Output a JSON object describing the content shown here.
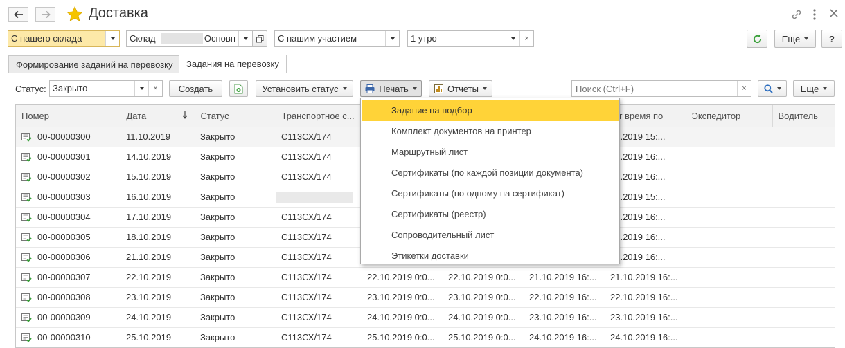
{
  "header": {
    "title": "Доставка"
  },
  "filters": {
    "warehouse_filter": "С нашего склада",
    "warehouse_label": "Склад",
    "warehouse_value_suffix": "Основн",
    "participation": "С нашим участием",
    "shift": "1 утро",
    "more_label": "Еще",
    "help_label": "?"
  },
  "tabs": [
    {
      "label": "Формирование заданий на перевозку",
      "active": false
    },
    {
      "label": "Задания на перевозку",
      "active": true
    }
  ],
  "toolbar": {
    "status_label": "Статус:",
    "status_value": "Закрыто",
    "create_label": "Создать",
    "set_status_label": "Установить статус",
    "print_label": "Печать",
    "reports_label": "Отчеты",
    "search_placeholder": "Поиск (Ctrl+F)",
    "more_label": "Еще"
  },
  "table": {
    "columns": [
      "Номер",
      "Дата",
      "Статус",
      "Транспортное с...",
      "",
      "",
      "",
      "Факт время по",
      "Экспедитор",
      "Водитель"
    ],
    "sort_column": "Дата",
    "rows": [
      {
        "num": "00-00000300",
        "date": "11.10.2019",
        "status": "Закрыто",
        "transport": "С113СХ/174",
        "c4": "",
        "c5": "",
        "c6": "",
        "fact": "10.2019 15:..."
      },
      {
        "num": "00-00000301",
        "date": "14.10.2019",
        "status": "Закрыто",
        "transport": "С113СХ/174",
        "c4": "",
        "c5": "",
        "c6": "",
        "fact": "10.2019 16:..."
      },
      {
        "num": "00-00000302",
        "date": "15.10.2019",
        "status": "Закрыто",
        "transport": "С113СХ/174",
        "c4": "",
        "c5": "",
        "c6": "",
        "fact": "10.2019 16:..."
      },
      {
        "num": "00-00000303",
        "date": "16.10.2019",
        "status": "Закрыто",
        "transport": "",
        "c4": "",
        "c5": "",
        "c6": "",
        "fact": "10.2019 15:..."
      },
      {
        "num": "00-00000304",
        "date": "17.10.2019",
        "status": "Закрыто",
        "transport": "С113СХ/174",
        "c4": "",
        "c5": "",
        "c6": "",
        "fact": "10.2019 16:..."
      },
      {
        "num": "00-00000305",
        "date": "18.10.2019",
        "status": "Закрыто",
        "transport": "С113СХ/174",
        "c4": "",
        "c5": "",
        "c6": "",
        "fact": "10.2019 16:..."
      },
      {
        "num": "00-00000306",
        "date": "21.10.2019",
        "status": "Закрыто",
        "transport": "С113СХ/174",
        "c4": "",
        "c5": "",
        "c6": "",
        "fact": "10.2019 16:..."
      },
      {
        "num": "00-00000307",
        "date": "22.10.2019",
        "status": "Закрыто",
        "transport": "С113СХ/174",
        "c4": "22.10.2019 0:0...",
        "c5": "22.10.2019 0:0...",
        "c6": "21.10.2019 16:...",
        "fact": "21.10.2019 16:..."
      },
      {
        "num": "00-00000308",
        "date": "23.10.2019",
        "status": "Закрыто",
        "transport": "С113СХ/174",
        "c4": "23.10.2019 0:0...",
        "c5": "23.10.2019 0:0...",
        "c6": "22.10.2019 16:...",
        "fact": "22.10.2019 16:..."
      },
      {
        "num": "00-00000309",
        "date": "24.10.2019",
        "status": "Закрыто",
        "transport": "С113СХ/174",
        "c4": "24.10.2019 0:0...",
        "c5": "24.10.2019 0:0...",
        "c6": "23.10.2019 16:...",
        "fact": "23.10.2019 16:..."
      },
      {
        "num": "00-00000310",
        "date": "25.10.2019",
        "status": "Закрыто",
        "transport": "С113СХ/174",
        "c4": "25.10.2019 0:0...",
        "c5": "25.10.2019 0:0...",
        "c6": "24.10.2019 16:...",
        "fact": "24.10.2019 16:..."
      }
    ]
  },
  "print_menu": {
    "items": [
      {
        "label": "Задание на подбор",
        "selected": true
      },
      {
        "label": "Комплект документов на принтер",
        "selected": false
      },
      {
        "label": "Маршрутный лист",
        "selected": false
      },
      {
        "label": "Сертификаты (по каждой позиции документа)",
        "selected": false
      },
      {
        "label": "Сертификаты (по одному на сертификат)",
        "selected": false
      },
      {
        "label": "Сертификаты (реестр)",
        "selected": false
      },
      {
        "label": "Сопроводительный лист",
        "selected": false
      },
      {
        "label": "Этикетки доставки",
        "selected": false
      }
    ]
  },
  "colors": {
    "highlight": "#ffd338",
    "warehouse_filter_bg": "#fde9a8",
    "star": "#f5c400",
    "refresh_green": "#3aa03a"
  }
}
